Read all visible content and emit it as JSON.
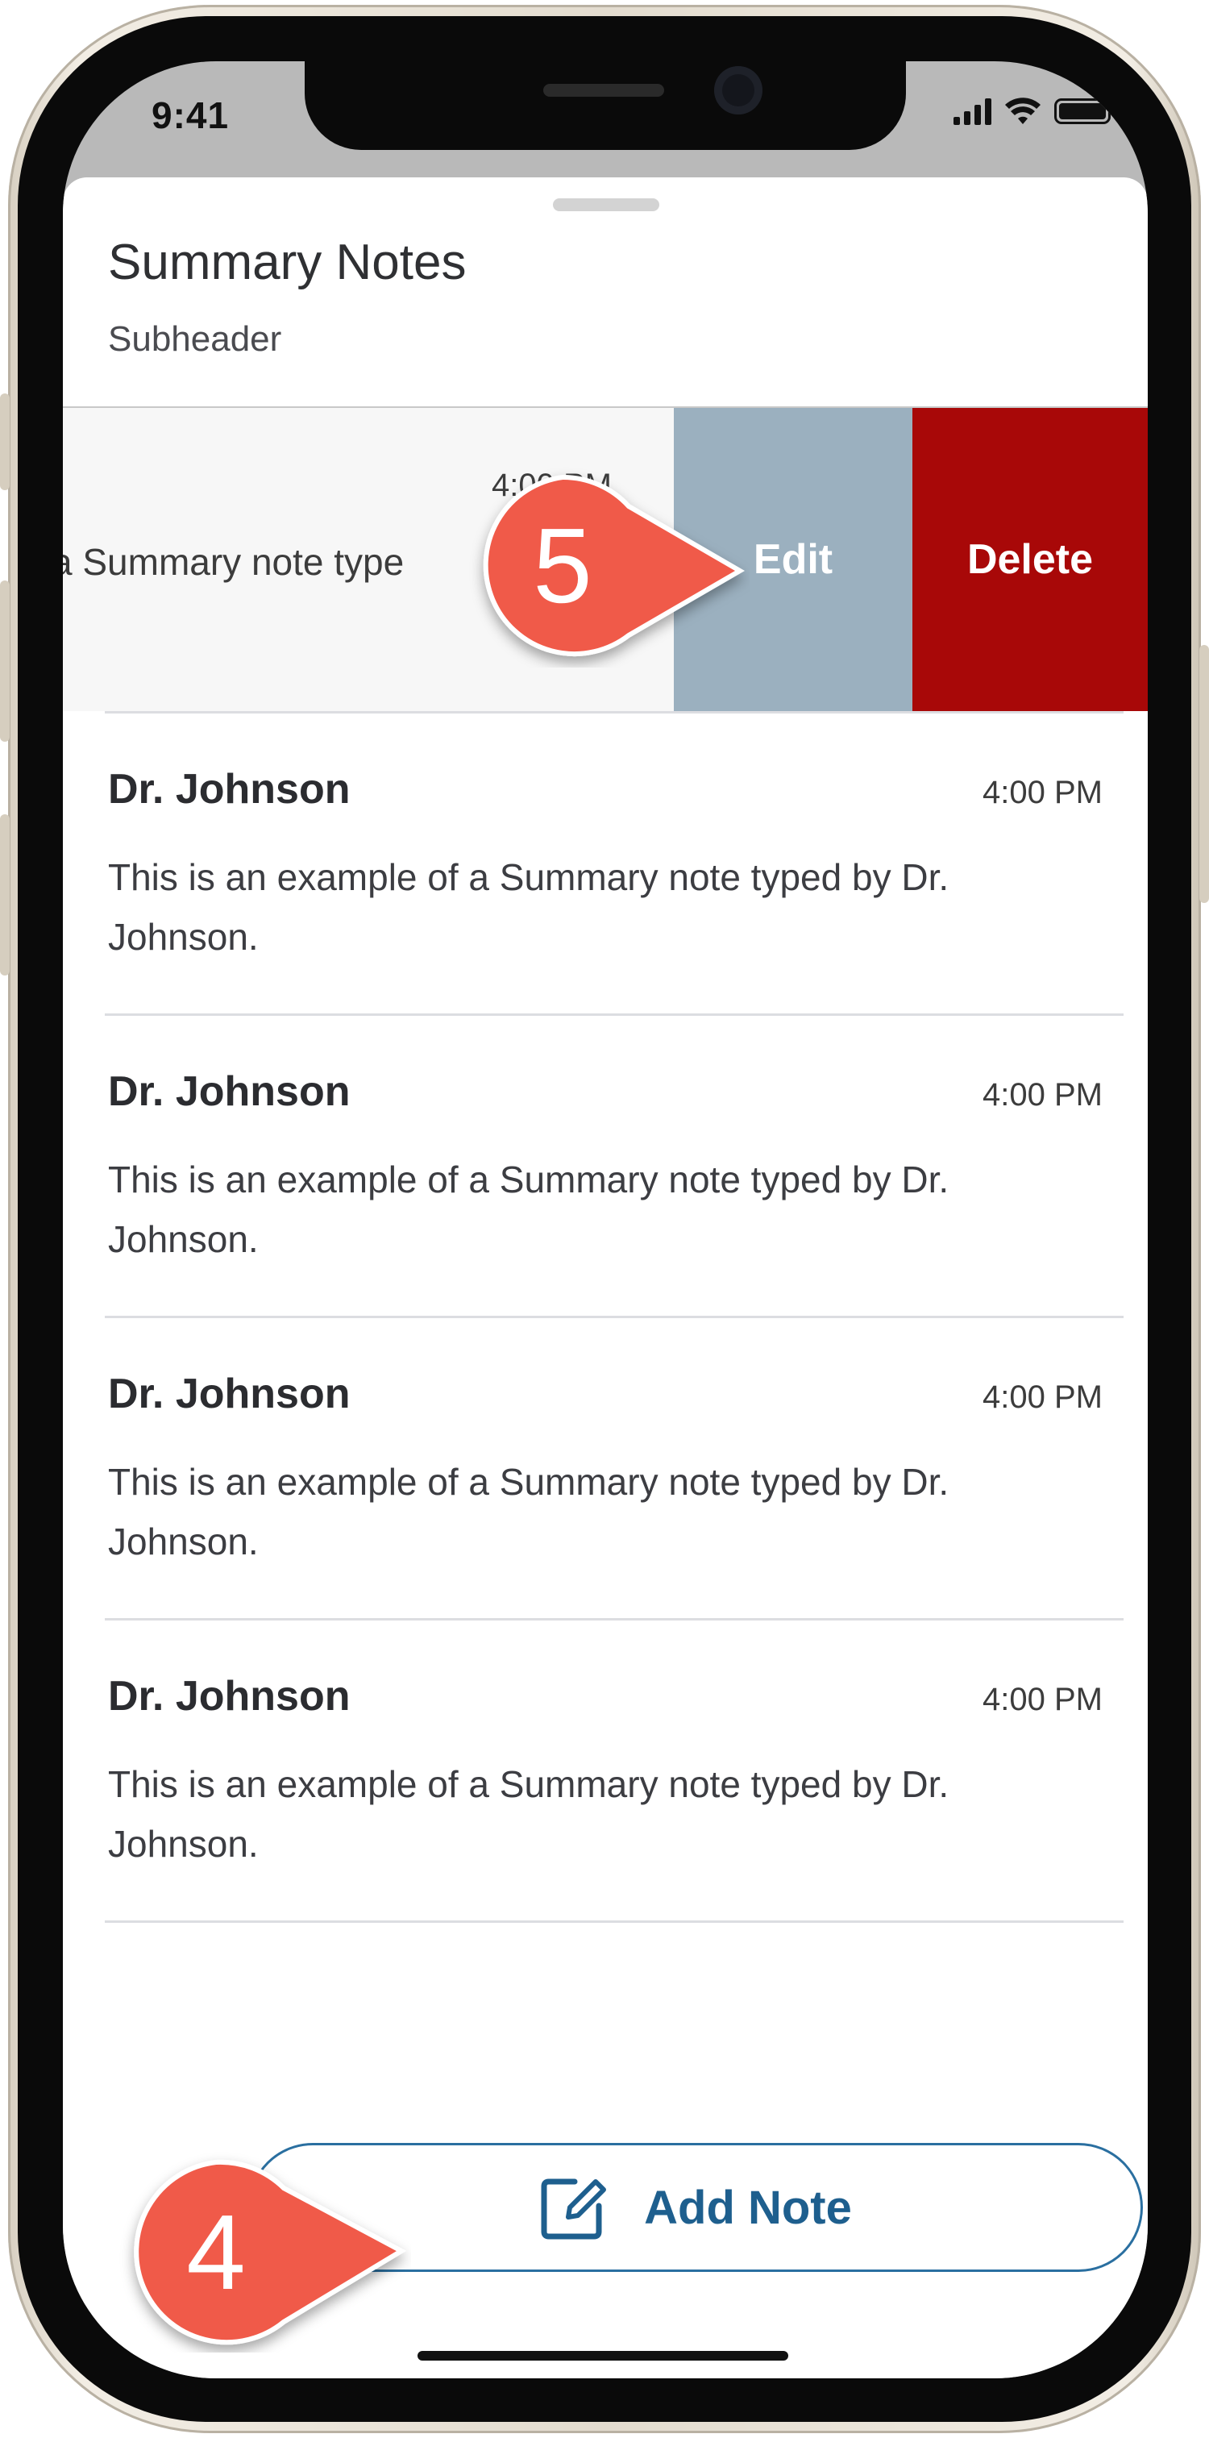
{
  "status_bar": {
    "time": "9:41"
  },
  "sheet": {
    "title": "Summary Notes",
    "subheader": "Subheader"
  },
  "swiped_row": {
    "time": "4:00 PM",
    "text": "a Summary note type",
    "edit_label": "Edit",
    "delete_label": "Delete",
    "colors": {
      "edit": "#9bb0bf",
      "delete": "#a80808"
    }
  },
  "notes": [
    {
      "author": "Dr. Johnson",
      "time": "4:00 PM",
      "body": "This is an example of a Summary note typed by Dr. Johnson."
    },
    {
      "author": "Dr. Johnson",
      "time": "4:00 PM",
      "body": "This is an example of a Summary note typed by Dr. Johnson."
    },
    {
      "author": "Dr. Johnson",
      "time": "4:00 PM",
      "body": "This is an example of a Summary note typed by Dr. Johnson."
    },
    {
      "author": "Dr. Johnson",
      "time": "4:00 PM",
      "body": "This is an example of a Summary note typed by Dr. Johnson."
    }
  ],
  "add_note": {
    "label": "Add Note",
    "icon": "edit-note-icon",
    "color": "#1e5f8e"
  },
  "callouts": [
    {
      "number": "5",
      "target": "edit-action",
      "color": "#f05a4a"
    },
    {
      "number": "4",
      "target": "add-note-button",
      "color": "#f05a4a"
    }
  ]
}
